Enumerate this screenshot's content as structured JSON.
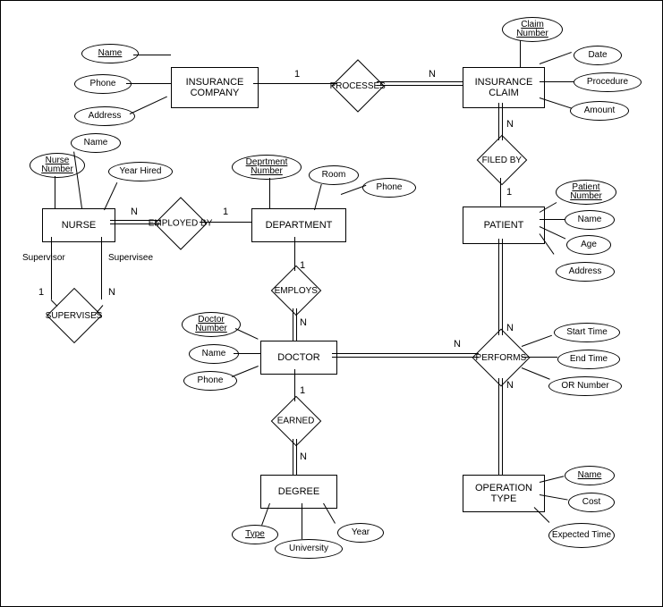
{
  "entities": {
    "ins_company": "INSURANCE COMPANY",
    "ins_claim": "INSURANCE CLAIM",
    "nurse": "NURSE",
    "department": "DEPARTMENT",
    "patient": "PATIENT",
    "doctor": "DOCTOR",
    "degree": "DEGREE",
    "op_type": "OPERATION TYPE"
  },
  "relationships": {
    "processes": "PROCESSES",
    "filed_by": "FILED BY",
    "employed_by": "EMPLOYED BY",
    "employs": "EMPLOYS",
    "supervises": "SUPERVISES",
    "earned": "EARNED",
    "performs": "PERFORMS"
  },
  "attributes": {
    "ins_company": {
      "name": "Name",
      "phone": "Phone",
      "address": "Address"
    },
    "ins_claim": {
      "claim_number": "Claim Number",
      "date": "Date",
      "procedure": "Procedure",
      "amount": "Amount"
    },
    "nurse": {
      "nurse_number": "Nurse Number",
      "name": "Name",
      "year_hired": "Year Hired"
    },
    "department": {
      "dept_number": "Deprtment Number",
      "room": "Room",
      "phone": "Phone"
    },
    "patient": {
      "patient_number": "Patient Number",
      "name": "Name",
      "age": "Age",
      "address": "Address"
    },
    "doctor": {
      "doctor_number": "Doctor Number",
      "name": "Name",
      "phone": "Phone"
    },
    "degree": {
      "type": "Type",
      "university": "University",
      "year": "Year"
    },
    "op_type": {
      "name": "Name",
      "cost": "Cost",
      "expected_time": "Expected Time"
    },
    "performs": {
      "start_time": "Start Time",
      "end_time": "End Time",
      "or_number": "OR Number"
    }
  },
  "roles": {
    "supervisor": "Supervisor",
    "supervisee": "Supervisee"
  },
  "card": {
    "one": "1",
    "many": "N"
  }
}
